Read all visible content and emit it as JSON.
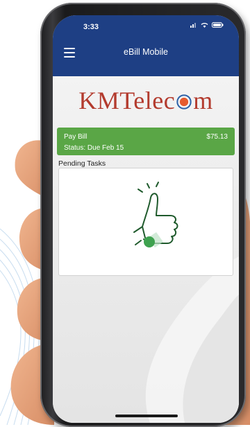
{
  "status_bar": {
    "time": "3:33"
  },
  "app_bar": {
    "title": "eBill Mobile"
  },
  "logo": {
    "text_before": "KMTelec",
    "text_after": "m"
  },
  "pay_bill": {
    "title": "Pay Bill",
    "status": "Status: Due Feb 15",
    "amount": "$75.13"
  },
  "pending": {
    "label": "Pending Tasks"
  },
  "icons": [
    "menu-icon",
    "signal-icon",
    "wifi-icon",
    "battery-icon",
    "thumbs-up-icon",
    "checkmark-icon"
  ],
  "colors": {
    "app_bar": "#1e3f84",
    "pay_bill": "#5aa646",
    "logo": "#b33b2e"
  }
}
